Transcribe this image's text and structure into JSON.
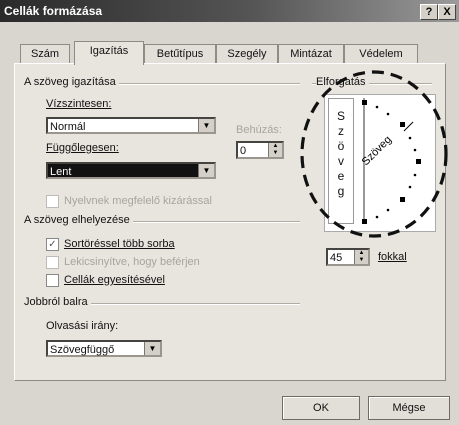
{
  "window": {
    "title": "Cellák formázása",
    "help_label": "?",
    "close_label": "X"
  },
  "tabs": [
    {
      "label": "Szám"
    },
    {
      "label": "Igazítás"
    },
    {
      "label": "Betűtípus"
    },
    {
      "label": "Szegély"
    },
    {
      "label": "Mintázat"
    },
    {
      "label": "Védelem"
    }
  ],
  "alignment": {
    "section_label": "A szöveg igazítása",
    "horizontal_label": "Vízszintesen:",
    "horizontal_value": "Normál",
    "indent_label": "Behúzás:",
    "indent_value": "0",
    "vertical_label": "Függőlegesen:",
    "vertical_value": "Lent",
    "justify_label": "Nyelvnek megfelelő kizárással",
    "justify_checked": false
  },
  "text_control": {
    "section_label": "A szöveg elhelyezése",
    "wrap_label": "Sortöréssel több sorba",
    "wrap_checked": true,
    "shrink_label": "Lekicsinyítve, hogy beférjen",
    "shrink_checked": false,
    "merge_label": "Cellák egyesítésével",
    "merge_checked": false
  },
  "rtl": {
    "section_label": "Jobbról balra",
    "direction_label": "Olvasási irány:",
    "direction_value": "Szövegfüggő"
  },
  "orientation": {
    "section_label": "Elforgatás",
    "vertical_text": [
      "S",
      "z",
      "ö",
      "v",
      "e",
      "g"
    ],
    "rotated_text": "Szöveg",
    "degrees_value": "45",
    "degrees_unit": "fokkal"
  },
  "buttons": {
    "ok_label": "OK",
    "cancel_label": "Mégse"
  }
}
